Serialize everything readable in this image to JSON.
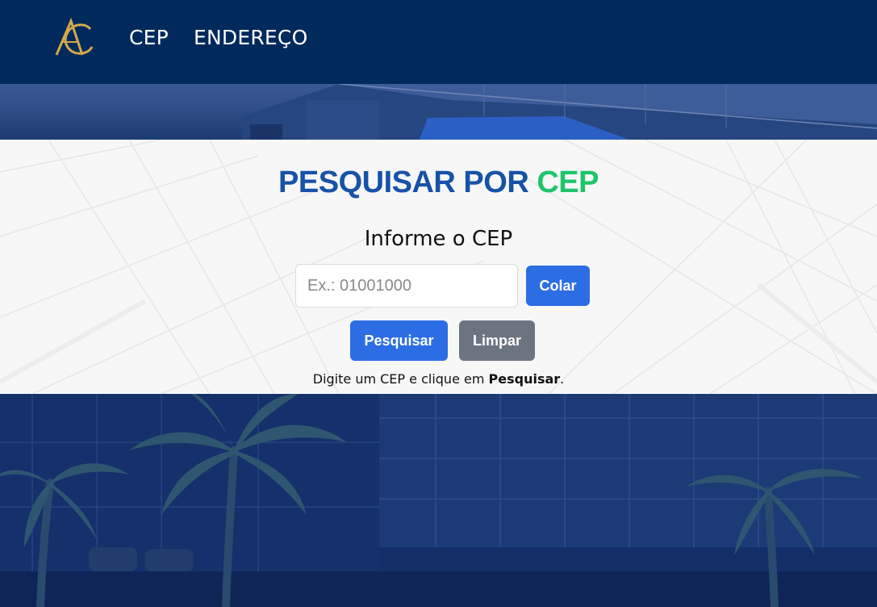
{
  "header": {
    "logo_icon": "ac-monogram-logo",
    "nav": [
      {
        "label": "CEP"
      },
      {
        "label": "ENDEREÇO"
      }
    ]
  },
  "search": {
    "title_part1": "PESQUISAR POR ",
    "title_part2": "CEP",
    "subtitle": "Informe o CEP",
    "placeholder": "Ex.: 01001000",
    "paste_label": "Colar",
    "search_label": "Pesquisar",
    "clear_label": "Limpar",
    "hint_prefix": "Digite um CEP e clique em ",
    "hint_bold": "Pesquisar",
    "hint_suffix": "."
  },
  "colors": {
    "header_bg": "#002a5c",
    "title_blue": "#1752a8",
    "title_green": "#1fc56a",
    "primary_button": "#2c6de3",
    "secondary_button": "#6c7480",
    "logo_gold": "#d4a94a"
  }
}
